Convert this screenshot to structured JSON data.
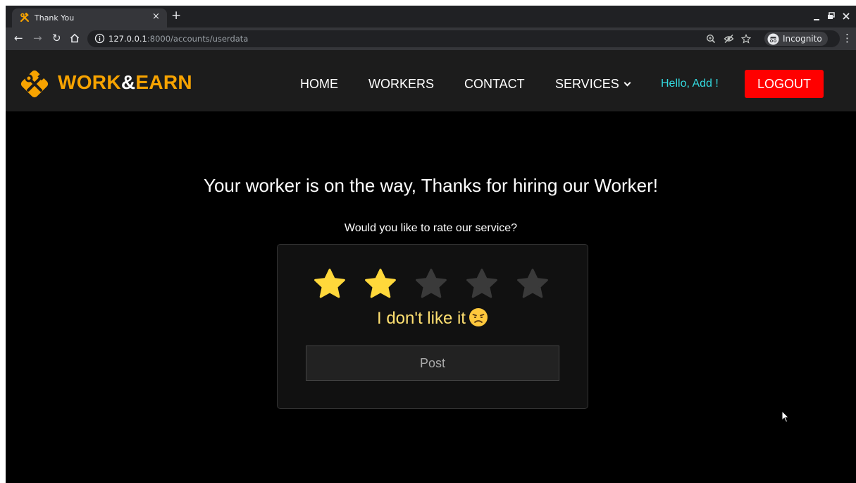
{
  "browser": {
    "tab_title": "Thank You",
    "tab_close": "×",
    "new_tab": "+",
    "url_host": "127.0.0.1",
    "url_rest": ":8000/accounts/userdata",
    "incognito_label": "Incognito",
    "icons": [
      "back-icon",
      "forward-icon",
      "reload-icon",
      "home-icon",
      "info-icon",
      "zoom-icon",
      "eye-off-icon",
      "star-bookmark-icon",
      "incognito-icon",
      "kebab-menu-icon"
    ]
  },
  "site": {
    "brand_part1": "WORK",
    "brand_amp": "&",
    "brand_part2": "EARN",
    "nav": {
      "home": "HOME",
      "workers": "WORKERS",
      "contact": "CONTACT",
      "services": "SERVICES"
    },
    "greeting": "Hello, Add !",
    "logout_label": "LOGOUT"
  },
  "content": {
    "thanks_message": "Your worker is on the way, Thanks for hiring our Worker!",
    "rate_question": "Would you like to rate our service?",
    "rating": {
      "value": 2,
      "max": 5
    },
    "feedback_text": "I don't like it",
    "post_label": "Post"
  },
  "colors": {
    "brand": "#f7a300",
    "greeting": "#33d9df",
    "logout": "#ff0000",
    "star_active": "#ffd83b",
    "star_inactive": "#3a3a3a",
    "feedback_text": "#ffe071"
  }
}
